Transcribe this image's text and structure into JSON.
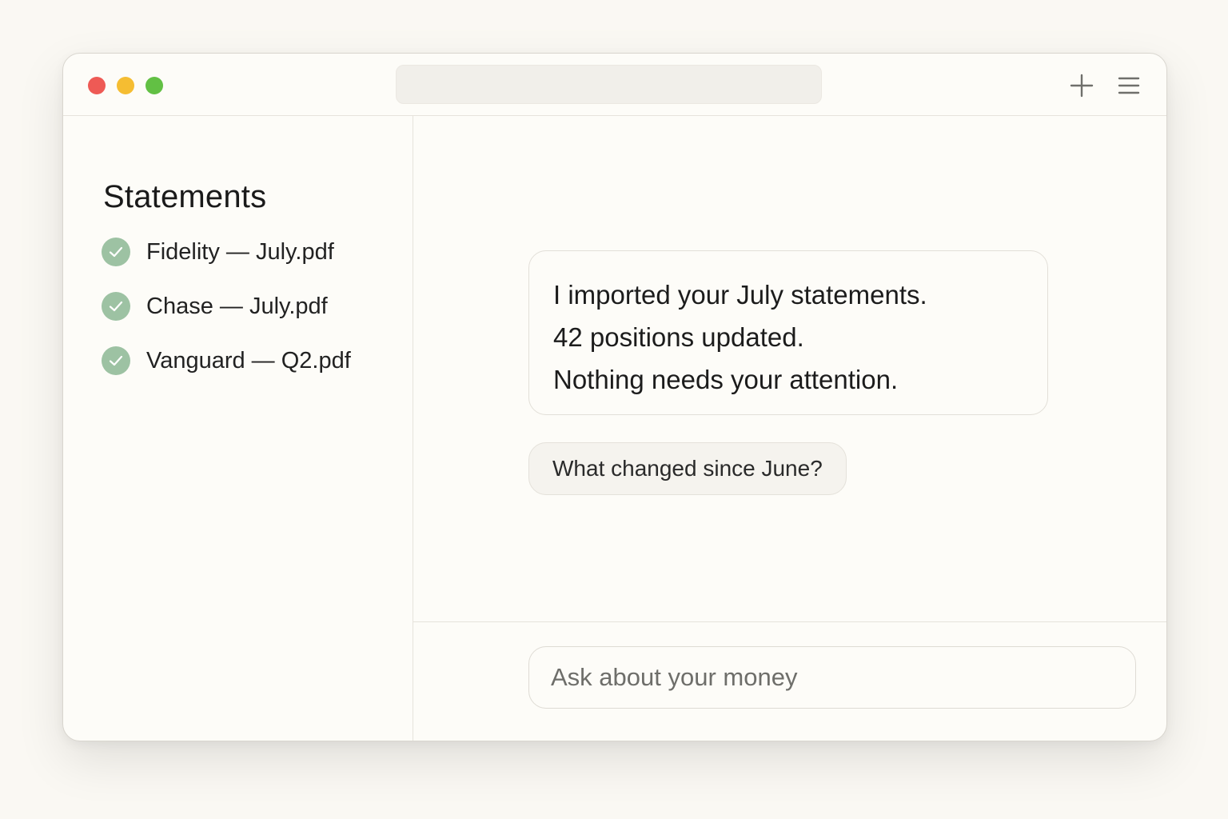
{
  "titlebar": {
    "address_value": "",
    "icons": [
      "plus-icon",
      "hamburger-menu-icon"
    ],
    "traffic_lights": {
      "close": "#ee5a55",
      "minimize": "#f5bd32",
      "zoom": "#62c044"
    }
  },
  "sidebar": {
    "title": "Statements",
    "files": [
      {
        "name": "Fidelity — July.pdf",
        "status": "check-icon"
      },
      {
        "name": "Chase — July.pdf",
        "status": "check-icon"
      },
      {
        "name": "Vanguard — Q2.pdf",
        "status": "check-icon"
      }
    ]
  },
  "chat": {
    "assistant_message": [
      "I imported your July statements.",
      "42 positions updated.",
      "Nothing needs your attention."
    ],
    "suggestion": "What changed since June?"
  },
  "composer": {
    "placeholder": "Ask about your money",
    "value": ""
  },
  "colors": {
    "background": "#faf8f3",
    "window": "#fdfcf8",
    "check": "#9dc2a3",
    "border": "#e6e3dc"
  }
}
